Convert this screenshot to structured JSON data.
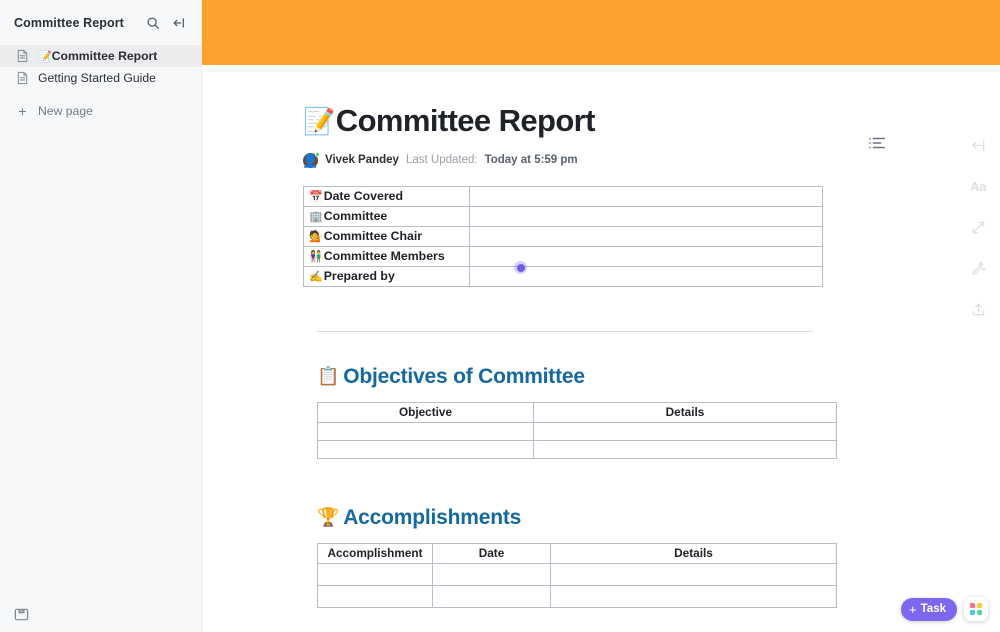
{
  "sidebar": {
    "title": "Committee Report",
    "search_icon": "search-icon",
    "collapse_icon": "collapse-sidebar-icon",
    "items": [
      {
        "emoji": "📝",
        "label": "Committee Report",
        "active": true
      },
      {
        "emoji": "",
        "label": "Getting Started Guide",
        "active": false
      }
    ],
    "new_page_label": "New page",
    "footer_icon": "archive-icon"
  },
  "document": {
    "cover_color": "#fda22e",
    "title_emoji": "📝",
    "title": "Committee Report",
    "author": "Vivek Pandey",
    "updated_label": "Last Updated:",
    "updated_value": "Today at 5:59 pm",
    "outline_icon": "outline-list-icon",
    "meta_table": {
      "rows": [
        {
          "emoji": "📅",
          "key": "Date Covered",
          "value": ""
        },
        {
          "emoji": "🏢",
          "key": "Committee",
          "value": ""
        },
        {
          "emoji": "💁",
          "key": "Committee Chair",
          "value": ""
        },
        {
          "emoji": "👫",
          "key": "Committee Members",
          "value": ""
        },
        {
          "emoji": "✍️",
          "key": "Prepared by",
          "value": ""
        }
      ]
    },
    "sections": [
      {
        "emoji": "📋",
        "heading": "Objectives of Committee",
        "columns": [
          "Objective",
          "Details"
        ],
        "rows": [
          [
            "",
            ""
          ],
          [
            "",
            ""
          ]
        ]
      },
      {
        "emoji": "🏆",
        "heading": "Accomplishments",
        "columns": [
          "Accomplishment",
          "Date",
          "Details"
        ],
        "rows": [
          [
            "",
            "",
            ""
          ],
          [
            "",
            "",
            ""
          ]
        ]
      }
    ]
  },
  "right_rail": {
    "buttons": [
      {
        "icon": "collapse-right-icon",
        "label": ""
      },
      {
        "icon": "font-aa-icon",
        "label": "Aa"
      },
      {
        "icon": "expand-icon",
        "label": ""
      },
      {
        "icon": "ai-sparkle-icon",
        "label": ""
      },
      {
        "icon": "share-upload-icon",
        "label": ""
      }
    ]
  },
  "floating": {
    "task_label": "Task",
    "task_plus": "+",
    "task_color": "#7b68ee",
    "apps_icon": "app-grid-icon",
    "apps_dot_colors": [
      "#ff6b8a",
      "#ffc93c",
      "#4fc3f7",
      "#5cd6a0"
    ]
  },
  "presence": {
    "color": "#6e5de7",
    "name": "collaborator-cursor"
  }
}
